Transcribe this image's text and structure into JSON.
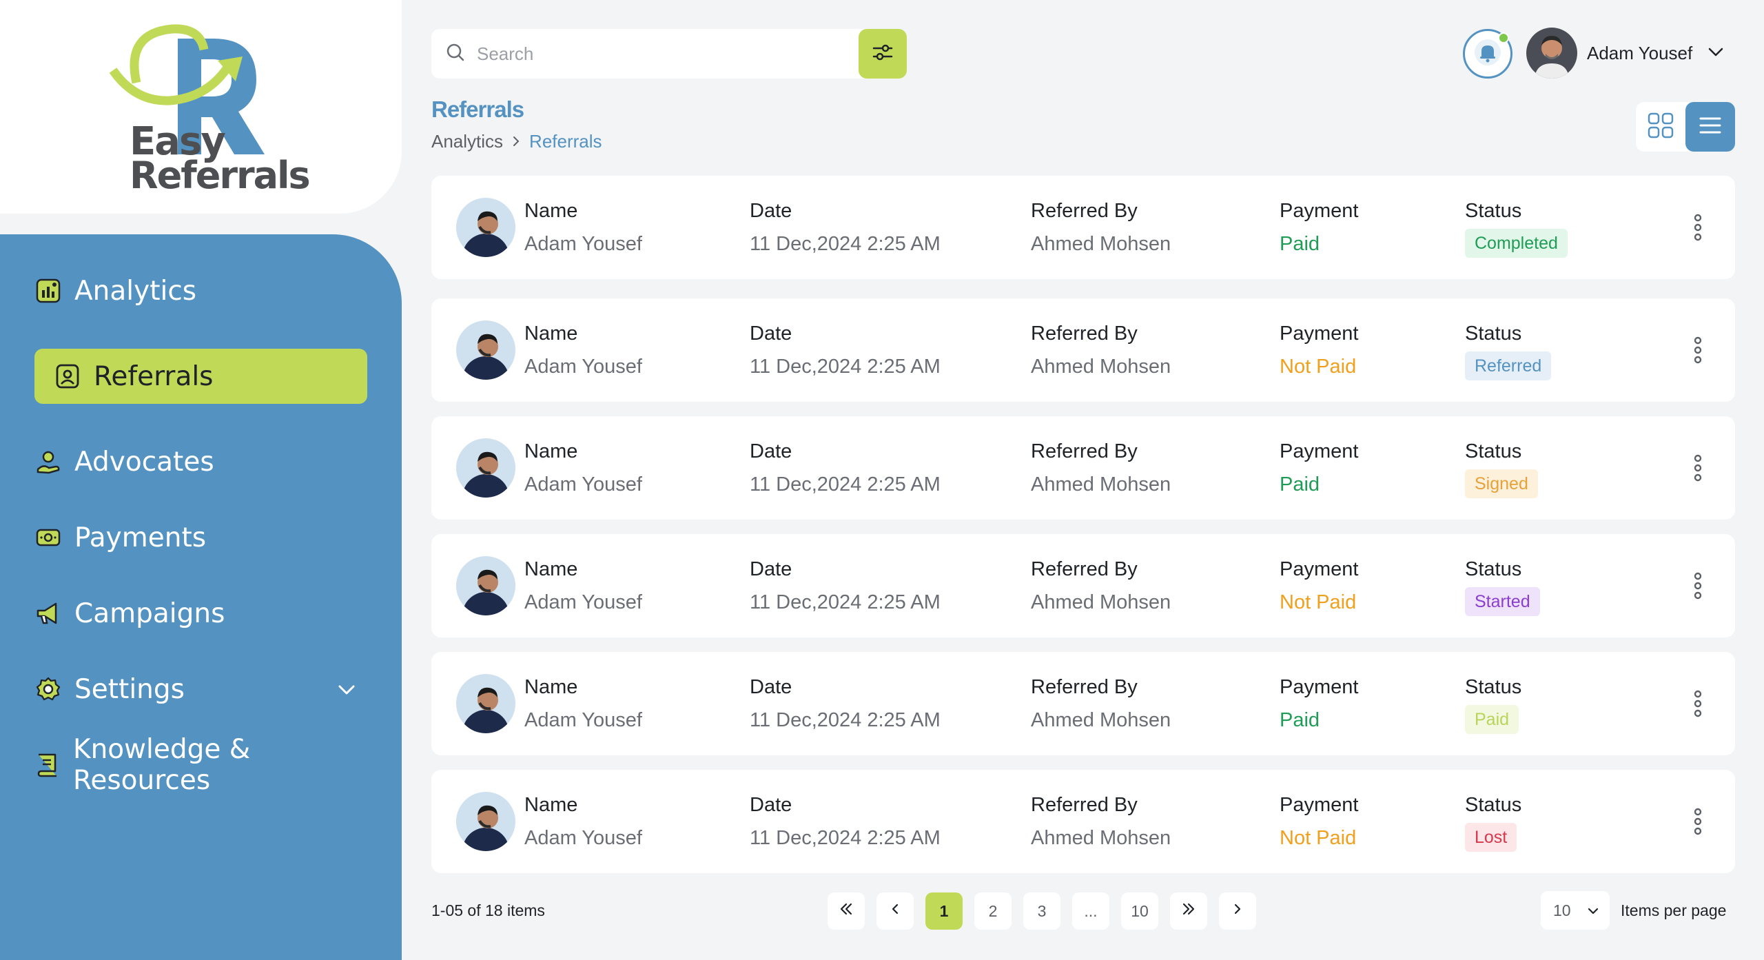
{
  "brand": {
    "logo_line1": "Easy",
    "logo_line2": "Referrals"
  },
  "sidebar": {
    "items": [
      {
        "label": "Analytics",
        "icon": "chart-icon"
      },
      {
        "label": "Referrals",
        "icon": "person-card-icon",
        "active": true
      },
      {
        "label": "Advocates",
        "icon": "advocate-icon"
      },
      {
        "label": "Payments",
        "icon": "wallet-icon"
      },
      {
        "label": "Campaigns",
        "icon": "megaphone-icon"
      },
      {
        "label": "Settings",
        "icon": "gear-icon",
        "has_dropdown": true
      },
      {
        "label": "Knowledge & Resources",
        "icon": "book-icon"
      }
    ]
  },
  "search": {
    "placeholder": "Search"
  },
  "user": {
    "name": "Adam Yousef"
  },
  "page": {
    "title": "Referrals",
    "breadcrumb": [
      "Analytics",
      "Referrals"
    ]
  },
  "table": {
    "labels": {
      "name": "Name",
      "date": "Date",
      "referred_by": "Referred By",
      "payment": "Payment",
      "status": "Status"
    },
    "rows": [
      {
        "name": "Adam Yousef",
        "date": "11 Dec,2024 2:25 AM",
        "referred_by": "Ahmed Mohsen",
        "payment": "Paid",
        "status": "Completed"
      },
      {
        "name": "Adam Yousef",
        "date": "11 Dec,2024 2:25 AM",
        "referred_by": "Ahmed Mohsen",
        "payment": "Not Paid",
        "status": "Referred"
      },
      {
        "name": "Adam Yousef",
        "date": "11 Dec,2024 2:25 AM",
        "referred_by": "Ahmed Mohsen",
        "payment": "Paid",
        "status": "Signed"
      },
      {
        "name": "Adam Yousef",
        "date": "11 Dec,2024 2:25 AM",
        "referred_by": "Ahmed Mohsen",
        "payment": "Not Paid",
        "status": "Started"
      },
      {
        "name": "Adam Yousef",
        "date": "11 Dec,2024 2:25 AM",
        "referred_by": "Ahmed Mohsen",
        "payment": "Paid",
        "status": "Paid"
      },
      {
        "name": "Adam Yousef",
        "date": "11 Dec,2024 2:25 AM",
        "referred_by": "Ahmed Mohsen",
        "payment": "Not Paid",
        "status": "Lost"
      }
    ]
  },
  "pagination": {
    "range_text": "1-05 of 18 items",
    "pages": [
      "1",
      "2",
      "3",
      "...",
      "10"
    ],
    "current": "1",
    "per_page": "10",
    "per_page_label": "Items per page"
  },
  "colors": {
    "brand_blue": "#5493c1",
    "brand_green": "#c0da58",
    "paid": "#1f9d57",
    "not_paid": "#f0a01c"
  }
}
